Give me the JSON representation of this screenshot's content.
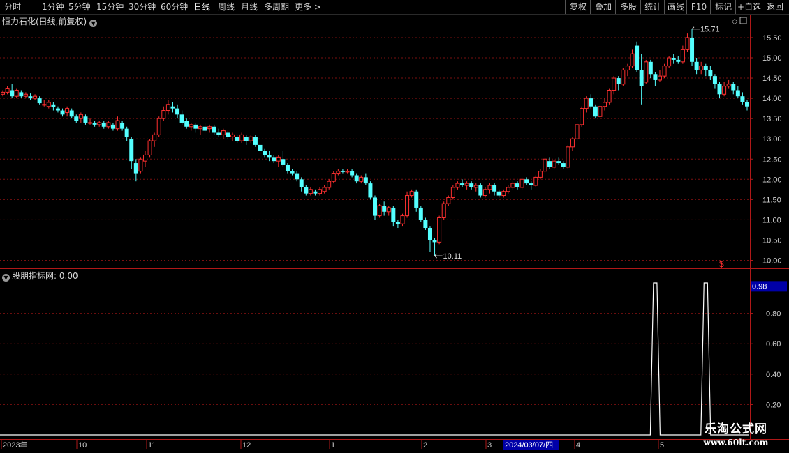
{
  "toolbar": {
    "periods": [
      "分时",
      "1分钟",
      "5分钟",
      "15分钟",
      "30分钟",
      "60分钟",
      "日线",
      "周线",
      "月线",
      "多周期",
      "更多 >"
    ],
    "active_period": "日线",
    "right_buttons": [
      "复权",
      "叠加",
      "多股",
      "统计",
      "画线",
      "F10",
      "标记",
      "+自选",
      "返回"
    ]
  },
  "main_panel": {
    "title": "恒力石化(日线,前复权)",
    "collapse_icon": "chevron-down-icon",
    "diamond_icon": "◇",
    "price_axis": [
      "15.50",
      "15.00",
      "14.50",
      "14.00",
      "13.50",
      "13.00",
      "12.50",
      "12.00",
      "11.50",
      "11.00",
      "10.50",
      "10.00"
    ],
    "high_label": "15.71",
    "low_label": "10.11",
    "dollar_marker": "$"
  },
  "sub_panel": {
    "title": "股朋指标网",
    "value_text": ": 0.00",
    "current_value_badge": "0.98",
    "axis": [
      "0.80",
      "0.60",
      "0.40",
      "0.20"
    ]
  },
  "date_axis": {
    "labels": [
      "2023年",
      "10",
      "11",
      "12",
      "1",
      "2",
      "3",
      "4",
      "5"
    ],
    "cursor_date": "2024/03/07/四"
  },
  "colors": {
    "up": "#ff3030",
    "down": "#54ffff",
    "grid": "#7a1010",
    "axis_line": "#b01818",
    "text": "#d0d0d0",
    "badge_bg": "#0000a8",
    "indicator_line": "#ffffff"
  },
  "watermark": {
    "line1": "乐淘公式网",
    "line2": "www.60lt.com"
  },
  "chart_data": {
    "type": "candlestick",
    "price_range": [
      10.0,
      15.75
    ],
    "candles": [
      [
        14.1,
        14.15,
        14.05,
        14.2
      ],
      [
        14.15,
        14.25,
        14.1,
        14.3
      ],
      [
        14.2,
        14.05,
        14.0,
        14.35
      ],
      [
        14.05,
        14.2,
        14.0,
        14.25
      ],
      [
        14.15,
        14.05,
        14.0,
        14.2
      ],
      [
        14.05,
        14.1,
        14.0,
        14.15
      ],
      [
        14.05,
        14.0,
        13.95,
        14.12
      ],
      [
        14.0,
        14.05,
        13.95,
        14.1
      ],
      [
        14.0,
        13.88,
        13.85,
        14.05
      ],
      [
        13.85,
        13.85,
        13.8,
        13.95
      ],
      [
        13.8,
        13.9,
        13.75,
        13.95
      ],
      [
        13.85,
        13.78,
        13.7,
        13.9
      ],
      [
        13.75,
        13.7,
        13.65,
        13.8
      ],
      [
        13.7,
        13.6,
        13.55,
        13.75
      ],
      [
        13.65,
        13.75,
        13.55,
        13.8
      ],
      [
        13.7,
        13.55,
        13.5,
        13.75
      ],
      [
        13.55,
        13.45,
        13.4,
        13.6
      ],
      [
        13.5,
        13.6,
        13.4,
        13.65
      ],
      [
        13.55,
        13.4,
        13.35,
        13.6
      ],
      [
        13.4,
        13.4,
        13.35,
        13.5
      ],
      [
        13.4,
        13.35,
        13.3,
        13.45
      ],
      [
        13.35,
        13.4,
        13.3,
        13.45
      ],
      [
        13.4,
        13.3,
        13.25,
        13.45
      ],
      [
        13.3,
        13.4,
        13.25,
        13.45
      ],
      [
        13.35,
        13.25,
        13.2,
        13.4
      ],
      [
        13.25,
        13.45,
        13.2,
        13.55
      ],
      [
        13.4,
        13.25,
        13.2,
        13.45
      ],
      [
        13.25,
        13.05,
        12.95,
        13.3
      ],
      [
        13.0,
        12.45,
        12.25,
        13.05
      ],
      [
        12.4,
        12.15,
        11.95,
        12.5
      ],
      [
        12.2,
        12.5,
        12.15,
        12.55
      ],
      [
        12.45,
        12.6,
        12.3,
        12.7
      ],
      [
        12.6,
        12.95,
        12.55,
        13.0
      ],
      [
        12.95,
        13.1,
        12.8,
        13.15
      ],
      [
        13.1,
        13.5,
        13.05,
        13.55
      ],
      [
        13.5,
        13.7,
        13.45,
        13.8
      ],
      [
        13.7,
        13.85,
        13.6,
        13.95
      ],
      [
        13.8,
        13.75,
        13.65,
        13.9
      ],
      [
        13.75,
        13.6,
        13.5,
        13.85
      ],
      [
        13.6,
        13.4,
        13.35,
        13.7
      ],
      [
        13.45,
        13.3,
        13.25,
        13.5
      ],
      [
        13.3,
        13.35,
        13.2,
        13.4
      ],
      [
        13.35,
        13.25,
        13.15,
        13.4
      ],
      [
        13.25,
        13.3,
        13.1,
        13.35
      ],
      [
        13.3,
        13.2,
        13.15,
        13.4
      ],
      [
        13.25,
        13.3,
        13.15,
        13.35
      ],
      [
        13.3,
        13.15,
        13.1,
        13.35
      ],
      [
        13.15,
        13.1,
        13.05,
        13.25
      ],
      [
        13.1,
        13.2,
        13.0,
        13.25
      ],
      [
        13.15,
        13.05,
        13.0,
        13.2
      ],
      [
        13.05,
        13.1,
        12.95,
        13.15
      ],
      [
        13.05,
        12.95,
        12.9,
        13.1
      ],
      [
        12.95,
        13.1,
        12.9,
        13.15
      ],
      [
        13.05,
        12.95,
        12.85,
        13.1
      ],
      [
        12.95,
        13.05,
        12.9,
        13.1
      ],
      [
        13.05,
        12.85,
        12.8,
        13.1
      ],
      [
        12.85,
        12.7,
        12.65,
        12.9
      ],
      [
        12.7,
        12.6,
        12.55,
        12.75
      ],
      [
        12.6,
        12.55,
        12.45,
        12.7
      ],
      [
        12.55,
        12.45,
        12.4,
        12.6
      ],
      [
        12.45,
        12.55,
        12.3,
        12.6
      ],
      [
        12.5,
        12.35,
        12.3,
        12.7
      ],
      [
        12.35,
        12.2,
        12.15,
        12.4
      ],
      [
        12.2,
        12.15,
        12.1,
        12.25
      ],
      [
        12.15,
        12.0,
        11.95,
        12.2
      ],
      [
        12.0,
        11.8,
        11.7,
        12.05
      ],
      [
        11.8,
        11.65,
        11.6,
        11.85
      ],
      [
        11.65,
        11.75,
        11.6,
        11.8
      ],
      [
        11.7,
        11.65,
        11.6,
        11.75
      ],
      [
        11.65,
        11.75,
        11.6,
        11.8
      ],
      [
        11.7,
        11.8,
        11.65,
        11.85
      ],
      [
        11.8,
        11.95,
        11.75,
        12.0
      ],
      [
        11.95,
        12.15,
        11.9,
        12.2
      ],
      [
        12.15,
        12.2,
        12.1,
        12.25
      ],
      [
        12.2,
        12.18,
        12.15,
        12.25
      ],
      [
        12.18,
        12.2,
        12.15,
        12.25
      ],
      [
        12.2,
        12.1,
        12.05,
        12.25
      ],
      [
        12.1,
        11.95,
        11.9,
        12.15
      ],
      [
        11.95,
        12.05,
        11.9,
        12.1
      ],
      [
        12.05,
        11.9,
        11.85,
        12.15
      ],
      [
        11.9,
        11.55,
        11.5,
        11.95
      ],
      [
        11.55,
        11.1,
        11.0,
        11.6
      ],
      [
        11.1,
        11.35,
        11.05,
        11.4
      ],
      [
        11.35,
        11.2,
        11.1,
        11.45
      ],
      [
        11.2,
        11.3,
        11.1,
        11.35
      ],
      [
        11.3,
        10.95,
        10.85,
        11.35
      ],
      [
        10.95,
        10.9,
        10.8,
        11.0
      ],
      [
        10.9,
        11.1,
        10.85,
        11.15
      ],
      [
        11.1,
        11.6,
        11.05,
        11.7
      ],
      [
        11.6,
        11.7,
        11.55,
        11.75
      ],
      [
        11.7,
        11.3,
        11.2,
        11.75
      ],
      [
        11.3,
        11.0,
        10.95,
        11.35
      ],
      [
        11.0,
        10.8,
        10.75,
        11.05
      ],
      [
        10.8,
        10.5,
        10.2,
        10.85
      ],
      [
        10.5,
        10.45,
        10.11,
        10.55
      ],
      [
        10.45,
        11.05,
        10.4,
        11.1
      ],
      [
        11.05,
        11.4,
        11.0,
        11.45
      ],
      [
        11.4,
        11.55,
        11.35,
        11.6
      ],
      [
        11.55,
        11.8,
        11.5,
        11.85
      ],
      [
        11.8,
        11.9,
        11.75,
        11.95
      ],
      [
        11.9,
        11.85,
        11.8,
        12.0
      ],
      [
        11.85,
        11.9,
        11.75,
        11.95
      ],
      [
        11.9,
        11.8,
        11.75,
        11.95
      ],
      [
        11.8,
        11.85,
        11.7,
        11.9
      ],
      [
        11.85,
        11.6,
        11.55,
        11.9
      ],
      [
        11.6,
        11.75,
        11.55,
        11.8
      ],
      [
        11.75,
        11.85,
        11.65,
        11.9
      ],
      [
        11.85,
        11.7,
        11.6,
        11.9
      ],
      [
        11.7,
        11.6,
        11.55,
        11.75
      ],
      [
        11.6,
        11.7,
        11.55,
        11.75
      ],
      [
        11.7,
        11.8,
        11.65,
        11.85
      ],
      [
        11.8,
        11.9,
        11.75,
        11.95
      ],
      [
        11.9,
        11.8,
        11.75,
        11.95
      ],
      [
        11.8,
        12.0,
        11.75,
        12.05
      ],
      [
        12.0,
        11.9,
        11.85,
        12.05
      ],
      [
        11.9,
        11.85,
        11.75,
        11.95
      ],
      [
        11.85,
        12.05,
        11.8,
        12.1
      ],
      [
        12.05,
        12.2,
        12.0,
        12.25
      ],
      [
        12.2,
        12.5,
        12.15,
        12.55
      ],
      [
        12.45,
        12.3,
        12.25,
        12.55
      ],
      [
        12.3,
        12.45,
        12.25,
        12.5
      ],
      [
        12.45,
        12.4,
        12.35,
        12.55
      ],
      [
        12.4,
        12.3,
        12.25,
        12.45
      ],
      [
        12.3,
        12.8,
        12.25,
        12.85
      ],
      [
        12.8,
        13.0,
        12.7,
        13.05
      ],
      [
        13.0,
        13.35,
        12.95,
        13.4
      ],
      [
        13.35,
        13.75,
        13.3,
        13.8
      ],
      [
        13.75,
        14.0,
        13.65,
        14.05
      ],
      [
        14.0,
        13.8,
        13.75,
        14.1
      ],
      [
        13.8,
        13.55,
        13.5,
        13.85
      ],
      [
        13.55,
        13.8,
        13.5,
        13.85
      ],
      [
        13.8,
        13.9,
        13.7,
        14.0
      ],
      [
        13.9,
        14.2,
        13.85,
        14.25
      ],
      [
        14.2,
        14.5,
        14.1,
        14.55
      ],
      [
        14.5,
        14.35,
        14.2,
        14.55
      ],
      [
        14.35,
        14.7,
        14.3,
        14.75
      ],
      [
        14.7,
        14.8,
        14.55,
        14.85
      ],
      [
        14.8,
        15.1,
        14.75,
        15.2
      ],
      [
        15.3,
        14.7,
        14.65,
        15.4
      ],
      [
        14.7,
        14.3,
        13.85,
        15.1
      ],
      [
        14.4,
        14.9,
        14.35,
        14.95
      ],
      [
        14.9,
        14.6,
        14.5,
        14.95
      ],
      [
        14.6,
        14.45,
        14.3,
        14.65
      ],
      [
        14.45,
        14.55,
        14.4,
        14.7
      ],
      [
        14.55,
        14.8,
        14.5,
        14.85
      ],
      [
        14.8,
        15.0,
        14.75,
        15.05
      ],
      [
        15.0,
        14.95,
        14.85,
        15.1
      ],
      [
        14.95,
        14.9,
        14.85,
        15.05
      ],
      [
        14.9,
        15.2,
        14.85,
        15.3
      ],
      [
        15.2,
        15.5,
        15.15,
        15.6
      ],
      [
        15.5,
        14.9,
        14.8,
        15.71
      ],
      [
        14.9,
        14.7,
        14.6,
        15.0
      ],
      [
        14.7,
        14.8,
        14.6,
        14.9
      ],
      [
        14.8,
        14.7,
        14.55,
        14.85
      ],
      [
        14.7,
        14.55,
        14.45,
        14.8
      ],
      [
        14.55,
        14.35,
        14.25,
        14.6
      ],
      [
        14.35,
        14.1,
        14.0,
        14.4
      ],
      [
        14.1,
        14.3,
        14.05,
        14.4
      ],
      [
        14.3,
        14.35,
        14.25,
        14.45
      ],
      [
        14.35,
        14.2,
        14.1,
        14.4
      ],
      [
        14.2,
        14.05,
        14.0,
        14.3
      ],
      [
        14.05,
        13.9,
        13.85,
        14.15
      ],
      [
        13.9,
        13.8,
        13.7,
        13.95
      ]
    ],
    "indicator": {
      "name": "股朋指标网",
      "range": [
        0.0,
        1.0
      ],
      "spikes": [
        {
          "index": 142,
          "value": 1.0
        },
        {
          "index": 153,
          "value": 1.0
        }
      ]
    }
  }
}
